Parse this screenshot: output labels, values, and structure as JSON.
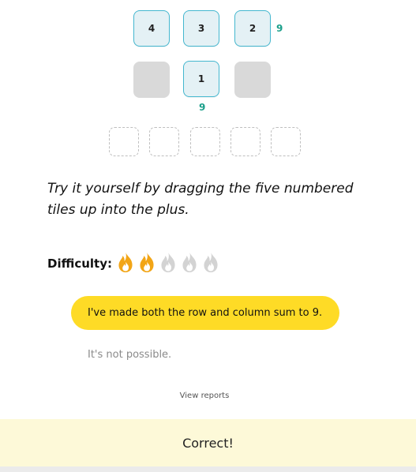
{
  "puzzle": {
    "top_row": [
      "4",
      "3",
      "2"
    ],
    "middle_tile": "1",
    "row_sum": "9",
    "column_sum": "9",
    "empty_slots": 5
  },
  "instructions": "Try it yourself by dragging the five numbered tiles up into the plus.",
  "difficulty": {
    "label": "Difficulty:",
    "level": 2,
    "max": 5,
    "active_color": "#f2a516",
    "inactive_color": "#d3d3d3"
  },
  "answers": {
    "selected": "I've made both the row and column sum to 9.",
    "alternative": "It's not possible."
  },
  "view_reports": "View reports",
  "result": "Correct!"
}
